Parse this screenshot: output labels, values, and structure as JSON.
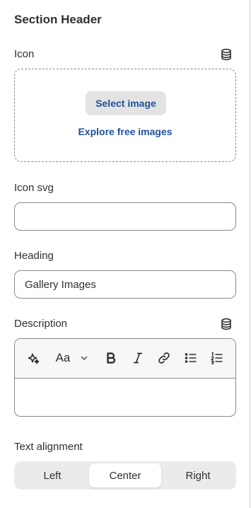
{
  "section": {
    "title": "Section Header"
  },
  "icon_field": {
    "label": "Icon",
    "select_button": "Select image",
    "explore_link": "Explore free images"
  },
  "icon_svg_field": {
    "label": "Icon svg",
    "value": ""
  },
  "heading_field": {
    "label": "Heading",
    "value": "Gallery Images"
  },
  "description_field": {
    "label": "Description",
    "toolbar": {
      "font_style_label": "Aa",
      "buttons": [
        "magic-icon",
        "font-style",
        "chevron-down-icon",
        "bold-icon",
        "italic-icon",
        "link-icon",
        "bullet-list-icon",
        "numbered-list-icon"
      ]
    },
    "value": ""
  },
  "text_alignment": {
    "label": "Text alignment",
    "options": [
      "Left",
      "Center",
      "Right"
    ],
    "selected": "Center"
  },
  "colors": {
    "link_blue": "#1f5199",
    "border": "#8a8a8a",
    "text": "#303030"
  }
}
